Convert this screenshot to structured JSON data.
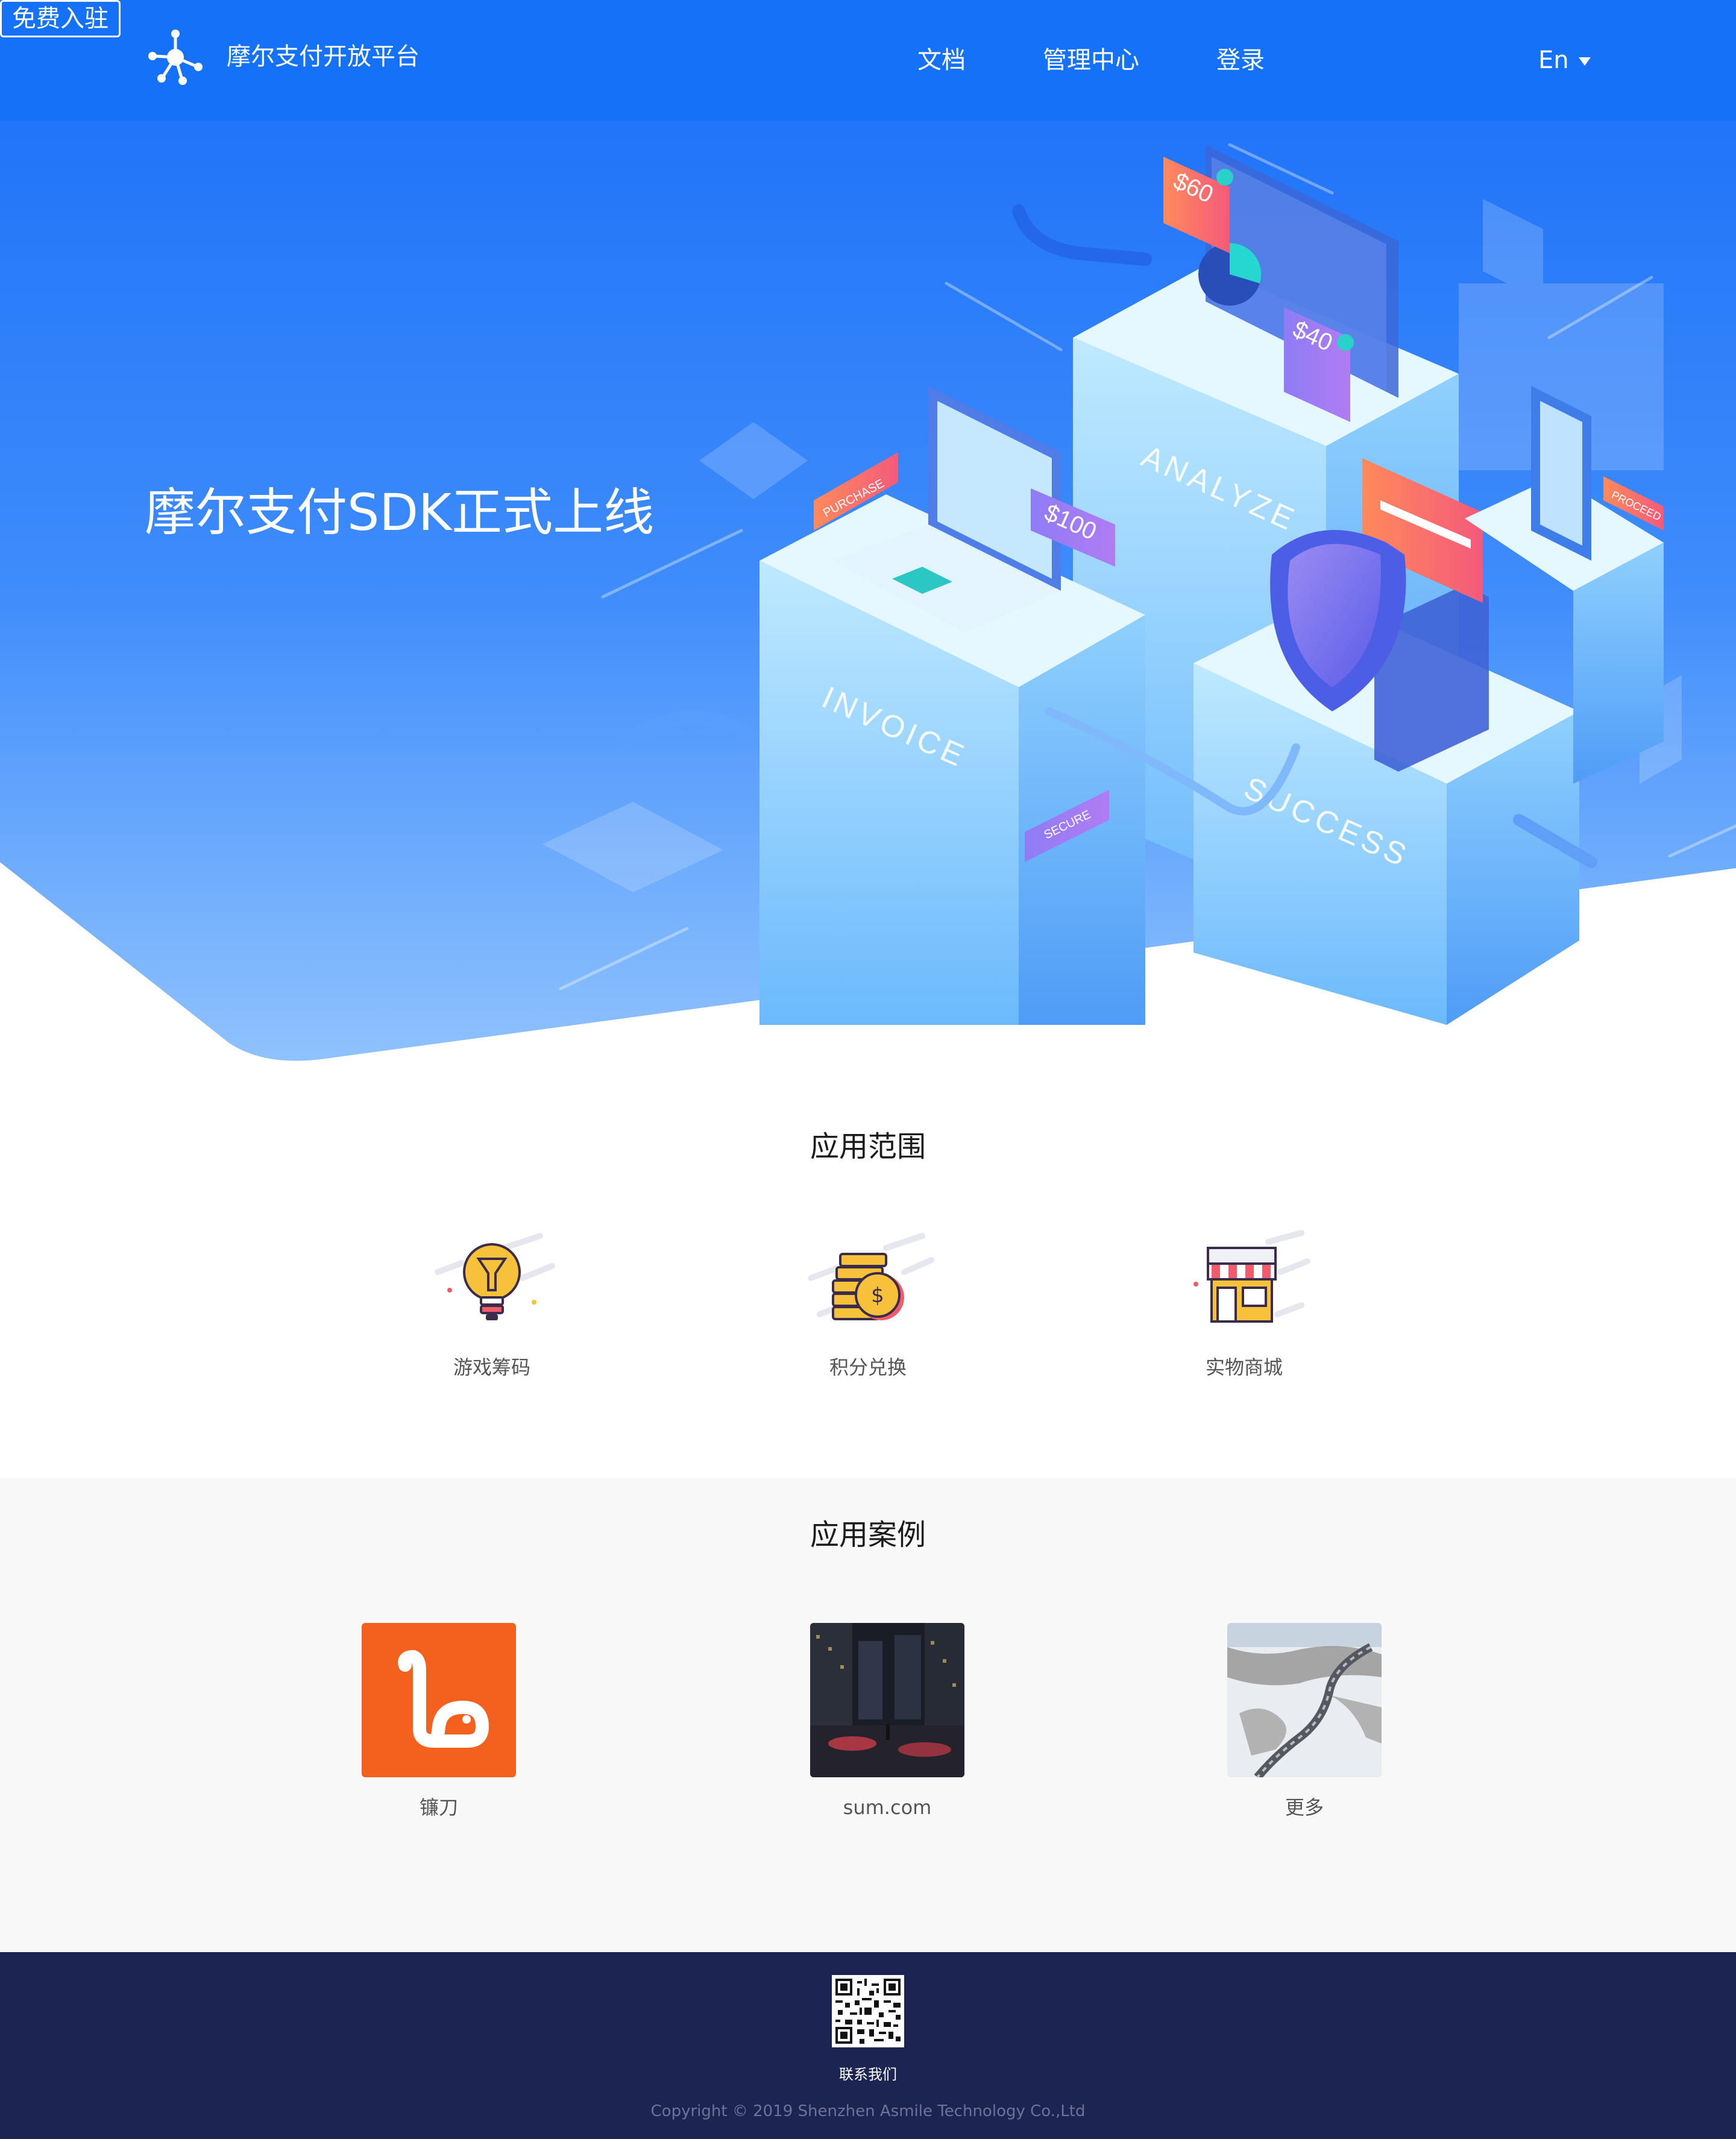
{
  "nav": {
    "brand": "摩尔支付开放平台",
    "links": [
      {
        "label": "文档"
      },
      {
        "label": "管理中心"
      },
      {
        "label": "登录"
      }
    ],
    "signup": "免费入驻",
    "lang": "En"
  },
  "hero": {
    "title": "摩尔支付SDK正式上线",
    "illustration": {
      "prices": [
        "$60",
        "$40",
        "$100"
      ],
      "tags": [
        "PURCHASE",
        "PROCEED",
        "SECURE"
      ],
      "blocks": [
        "ANALYZE",
        "INVOICE",
        "SUCCESS"
      ]
    }
  },
  "scope": {
    "title": "应用范围",
    "items": [
      {
        "label": "游戏筹码",
        "icon": "lightbulb-icon"
      },
      {
        "label": "积分兑换",
        "icon": "coins-icon"
      },
      {
        "label": "实物商城",
        "icon": "store-icon"
      }
    ]
  },
  "cases": {
    "title": "应用案例",
    "items": [
      {
        "label": "镰刀"
      },
      {
        "label": "sum.com"
      },
      {
        "label": "更多"
      }
    ]
  },
  "footer": {
    "contact": "联系我们",
    "copyright": "Copyright © 2019 Shenzhen Asmile Technology Co.,Ltd"
  },
  "colors": {
    "primary": "#1471f8",
    "footer_bg": "#1c2452",
    "section_alt_bg": "#f8f8f8"
  }
}
